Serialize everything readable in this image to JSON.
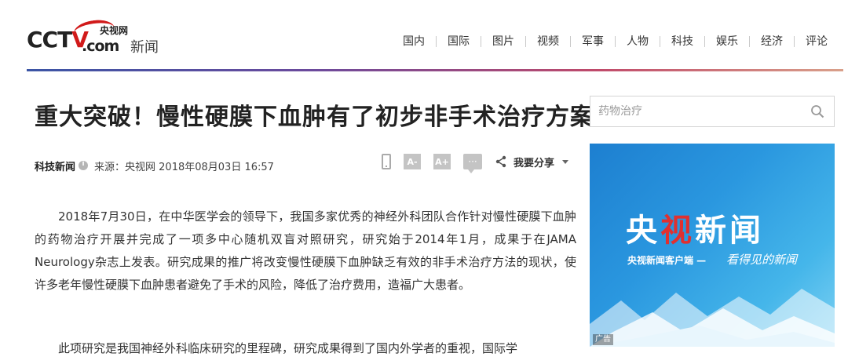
{
  "header": {
    "logo": {
      "cctv_pre": "CCT",
      "cctv_v": "V",
      "com": ".com",
      "site_name": "央视网",
      "section": "新闻"
    },
    "nav": [
      "国内",
      "国际",
      "图片",
      "视频",
      "军事",
      "人物",
      "科技",
      "娱乐",
      "经济",
      "评论"
    ]
  },
  "article": {
    "title": "重大突破！慢性硬膜下血肿有了初步非手术治疗方案",
    "category": "科技新闻",
    "source_line": "来源：央视网 2018年08月03日 16:57",
    "tools": {
      "font_decrease": "A-",
      "font_increase": "A+",
      "comment": "···",
      "share_label": "我要分享"
    },
    "paragraphs": [
      "2018年7月30日，在中华医学会的领导下，我国多家优秀的神经外科团队合作针对慢性硬膜下血肿的药物治疗开展并完成了一项多中心随机双盲对照研究，研究始于2014年1月，成果于在JAMA Neurology杂志上发表。研究成果的推广将改变慢性硬膜下血肿缺乏有效的非手术治疗方法的现状，使许多老年慢性硬膜下血肿患者避免了手术的风险，降低了治疗费用，造福广大患者。",
      "此项研究是我国神经外科临床研究的里程碑，研究成果得到了国内外学者的重视，国际学"
    ]
  },
  "sidebar": {
    "search": {
      "value": "",
      "placeholder": "药物治疗"
    },
    "ad": {
      "title_a": "央",
      "title_b": "视",
      "title_c": "新闻",
      "subtitle": "央视新闻客户端 —",
      "slogan": "看得见的新闻",
      "badge": "广告"
    }
  },
  "colors": {
    "brand_red": "#d11a1a",
    "ad_blue": "#2a97df",
    "rule_start": "#3b55a5",
    "rule_end": "#d9a08a"
  },
  "icons": [
    "phone-icon",
    "font-decrease-icon",
    "font-increase-icon",
    "comment-icon",
    "share-icon",
    "chevron-down-icon",
    "search-icon",
    "info-icon"
  ]
}
